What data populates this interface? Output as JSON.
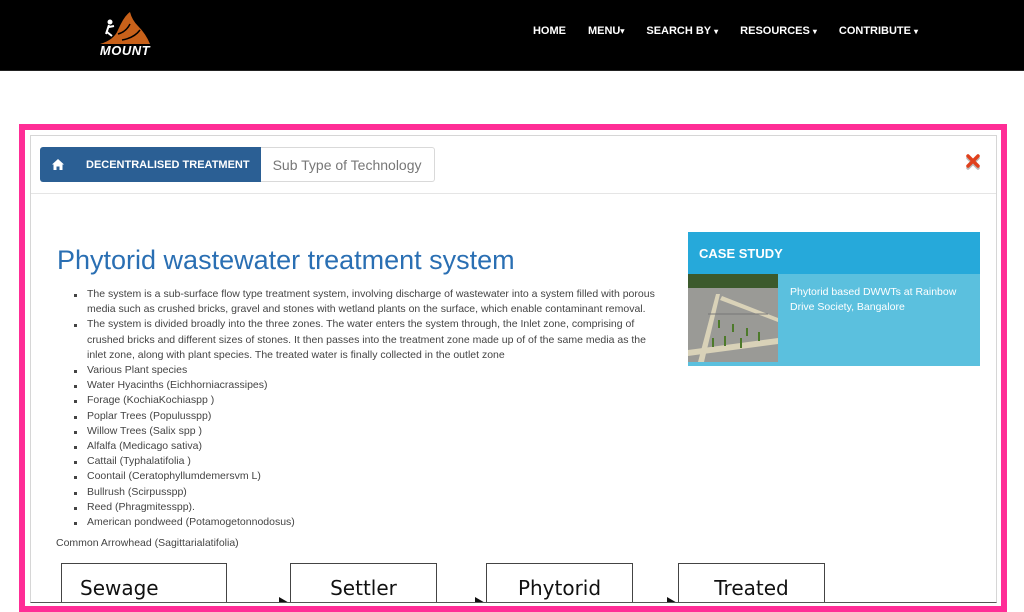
{
  "header": {
    "logo_text": "MOUNT",
    "nav": [
      {
        "label": "HOME",
        "has_caret": false
      },
      {
        "label": "MENU",
        "has_caret": true
      },
      {
        "label": "SEARCH BY",
        "has_caret": true
      },
      {
        "label": "RESOURCES",
        "has_caret": true
      },
      {
        "label": "CONTRIBUTE",
        "has_caret": true
      }
    ],
    "caret_glyph": "▾"
  },
  "breadcrumb": {
    "home_icon": "home-icon",
    "active": "DECENTRALISED TREATMENT",
    "sub": "Sub Type of Technology"
  },
  "close_icon": "close-icon",
  "accent_colors": {
    "frame": "#ff2d96",
    "breadcrumb": "#2b5f94",
    "title": "#2a6fb3",
    "case_head": "#26a9da",
    "case_body": "#5bc0de",
    "close": "#e0401c"
  },
  "article": {
    "title": "Phytorid wastewater treatment system",
    "bullets": [
      "The system is a sub-surface flow type treatment system, involving discharge of wastewater into a system filled with porous media such as crushed bricks, gravel and stones with wetland plants on the surface, which enable contaminant removal.",
      "The system is divided broadly into the three zones. The water enters the system through, the Inlet zone, comprising of crushed bricks and different sizes of stones. It then passes into the treatment zone made up of of the same media as the inlet zone, along with plant species. The treated water is finally collected in the outlet zone",
      "Various Plant species",
      "Water Hyacinths (Eichhorniacrassipes)",
      "Forage (KochiaKochiaspp )",
      "Poplar Trees (Populusspp)",
      "Willow Trees (Salix spp )",
      "Alfalfa (Medicago sativa)",
      "Cattail (Typhalatifolia )",
      "Coontail (Ceratophyllumdemersvm L)",
      "Bullrush (Scirpusspp)",
      "Reed (Phragmitesspp).",
      "American pondweed (Potamogetonnodosus)"
    ],
    "trailing_text": "Common Arrowhead (Sagittarialatifolia)"
  },
  "case_study": {
    "heading": "CASE STUDY",
    "link_text": "Phytorid based DWWTs at Rainbow Drive Society, Bangalore",
    "image_alt": "phytorid-bed-photo"
  },
  "flow_diagram": {
    "steps": [
      "Sewage",
      "Settler",
      "Phytorid",
      "Treated"
    ]
  }
}
